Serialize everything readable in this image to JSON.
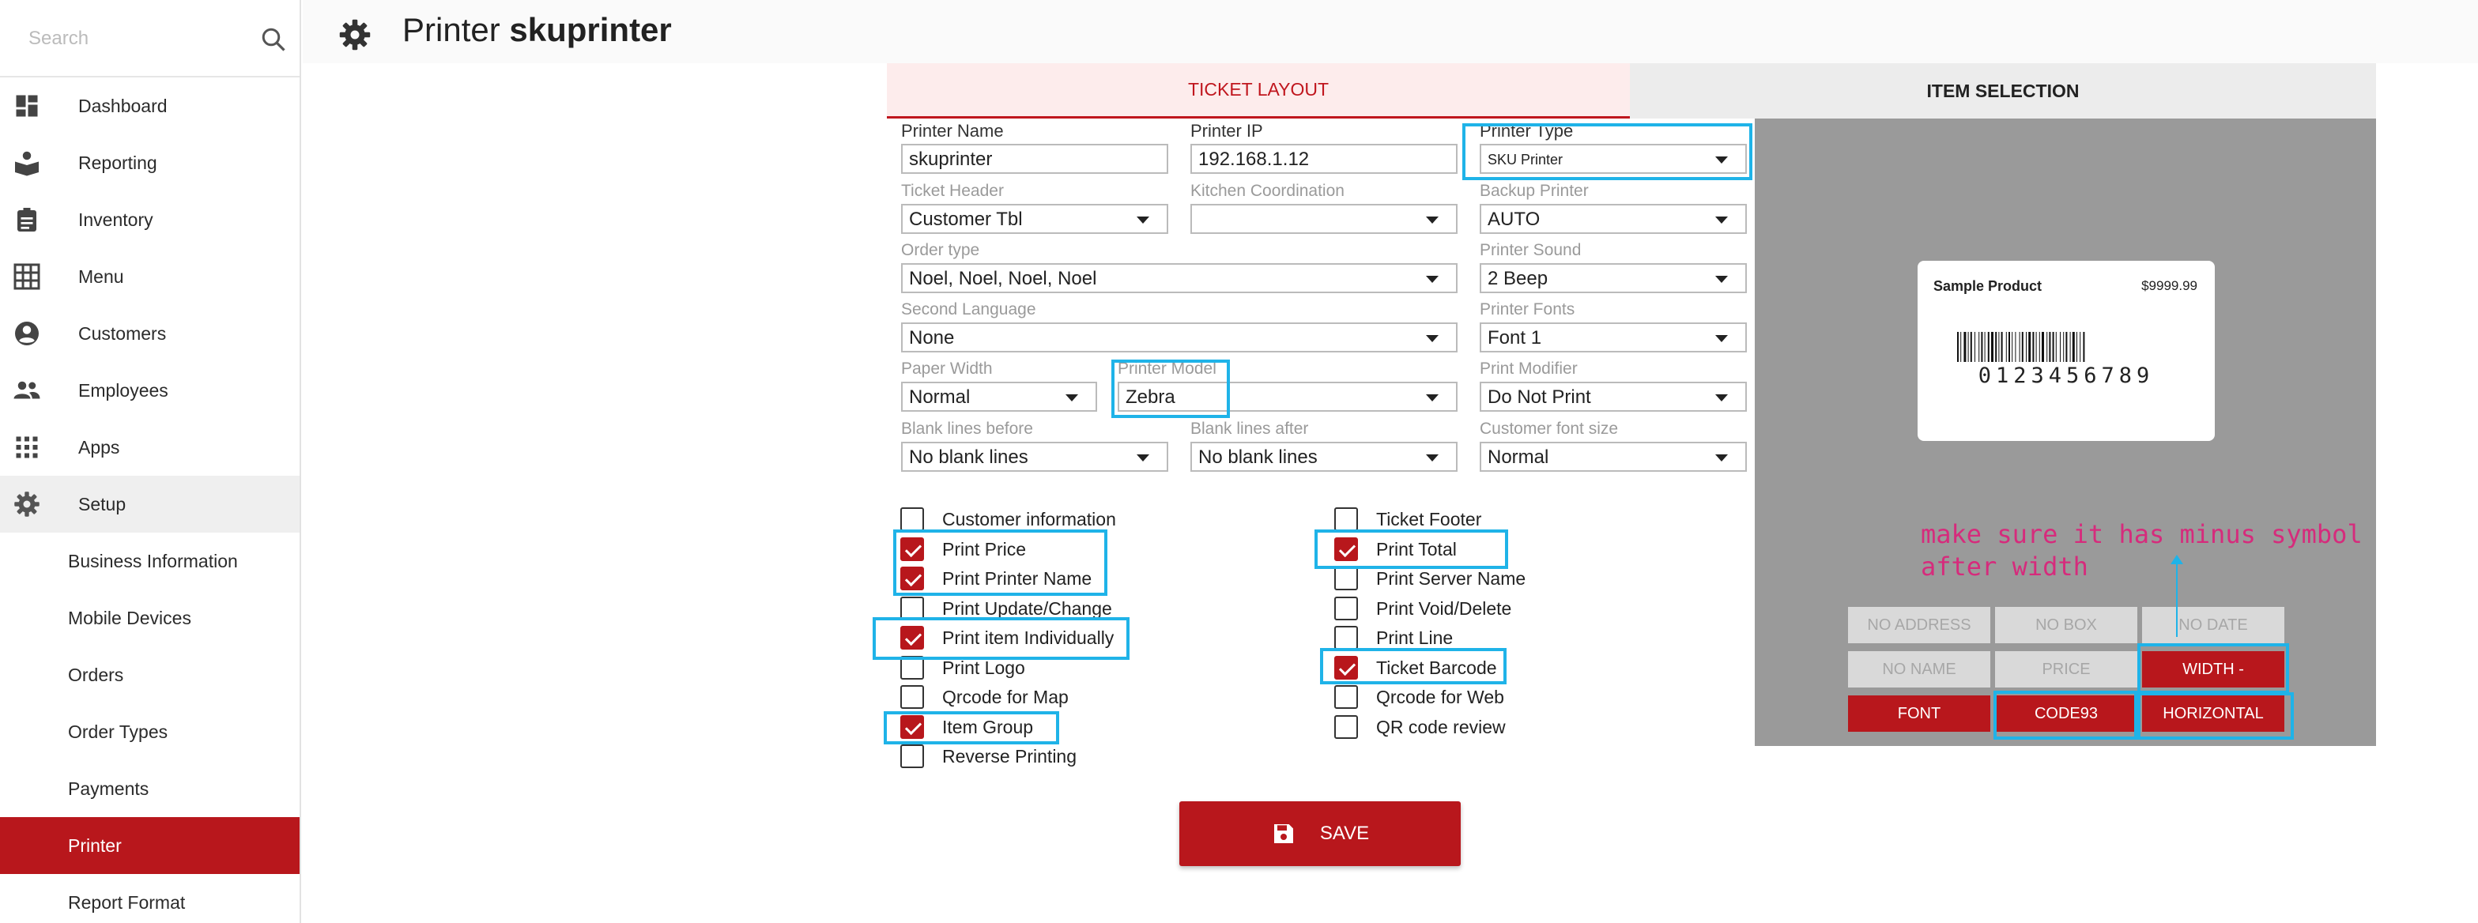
{
  "search": {
    "placeholder": "Search"
  },
  "sidebar": {
    "items": [
      {
        "label": "Dashboard",
        "icon": "dashboard-icon"
      },
      {
        "label": "Reporting",
        "icon": "reporting-icon"
      },
      {
        "label": "Inventory",
        "icon": "clipboard-icon"
      },
      {
        "label": "Menu",
        "icon": "grid-icon"
      },
      {
        "label": "Customers",
        "icon": "account-circle-icon"
      },
      {
        "label": "Employees",
        "icon": "people-icon"
      },
      {
        "label": "Apps",
        "icon": "apps-icon"
      },
      {
        "label": "Setup",
        "icon": "gear-icon"
      }
    ],
    "sub_items": [
      "Business Information",
      "Mobile Devices",
      "Orders",
      "Order Types",
      "Payments",
      "Printer",
      "Report Format"
    ]
  },
  "header": {
    "prefix": "Printer",
    "name": "skuprinter"
  },
  "tabs": {
    "ticket_layout": "TICKET LAYOUT",
    "item_selection": "ITEM SELECTION"
  },
  "form": {
    "printer_name": {
      "label": "Printer Name",
      "value": "skuprinter"
    },
    "printer_ip": {
      "label": "Printer IP",
      "value": "192.168.1.12"
    },
    "printer_type": {
      "label": "Printer Type",
      "value": "SKU Printer"
    },
    "ticket_header": {
      "label": "Ticket Header",
      "value": "Customer Tbl"
    },
    "kitchen_coordination": {
      "label": "Kitchen Coordination",
      "value": ""
    },
    "backup_printer": {
      "label": "Backup Printer",
      "value": "AUTO"
    },
    "order_type": {
      "label": "Order type",
      "value": "Noel, Noel, Noel, Noel"
    },
    "printer_sound": {
      "label": "Printer Sound",
      "value": "2 Beep"
    },
    "second_language": {
      "label": "Second Language",
      "value": "None"
    },
    "printer_fonts": {
      "label": "Printer Fonts",
      "value": "Font 1"
    },
    "paper_width": {
      "label": "Paper Width",
      "value": "Normal"
    },
    "printer_model": {
      "label": "Printer Model",
      "value": "Zebra"
    },
    "print_modifier": {
      "label": "Print Modifier",
      "value": "Do Not Print"
    },
    "blank_before": {
      "label": "Blank lines before",
      "value": "No blank lines"
    },
    "blank_after": {
      "label": "Blank lines after",
      "value": "No blank lines"
    },
    "customer_font_size": {
      "label": "Customer font size",
      "value": "Normal"
    }
  },
  "checkboxes_left": [
    {
      "label": "Customer information",
      "checked": false
    },
    {
      "label": "Print Price",
      "checked": true
    },
    {
      "label": "Print Printer Name",
      "checked": true
    },
    {
      "label": "Print Update/Change",
      "checked": false
    },
    {
      "label": "Print item Individually",
      "checked": true
    },
    {
      "label": "Print Logo",
      "checked": false
    },
    {
      "label": "Qrcode for Map",
      "checked": false
    },
    {
      "label": "Item Group",
      "checked": true
    },
    {
      "label": "Reverse Printing",
      "checked": false
    }
  ],
  "checkboxes_right": [
    {
      "label": "Ticket Footer",
      "checked": false
    },
    {
      "label": "Print Total",
      "checked": true
    },
    {
      "label": "Print Server Name",
      "checked": false
    },
    {
      "label": "Print Void/Delete",
      "checked": false
    },
    {
      "label": "Print Line",
      "checked": false
    },
    {
      "label": "Ticket Barcode",
      "checked": true
    },
    {
      "label": "Qrcode for Web",
      "checked": false
    },
    {
      "label": "QR code review",
      "checked": false
    }
  ],
  "preview": {
    "product_name": "Sample Product",
    "price": "$9999.99",
    "barcode_number": "0123456789",
    "buttons": [
      {
        "label": "NO ADDRESS",
        "state": "off"
      },
      {
        "label": "NO BOX",
        "state": "off"
      },
      {
        "label": "NO DATE",
        "state": "off"
      },
      {
        "label": "NO NAME",
        "state": "off"
      },
      {
        "label": "PRICE",
        "state": "off"
      },
      {
        "label": "WIDTH -",
        "state": "on"
      },
      {
        "label": "FONT",
        "state": "on"
      },
      {
        "label": "CODE93",
        "state": "on"
      },
      {
        "label": "HORIZONTAL",
        "state": "on"
      }
    ]
  },
  "annotation": {
    "line1": "make sure it has minus symbol",
    "line2": "after width"
  },
  "save_label": "SAVE",
  "colors": {
    "accent": "#b8171c",
    "highlight": "#1fb3e8",
    "annotation": "#d62b7c"
  }
}
